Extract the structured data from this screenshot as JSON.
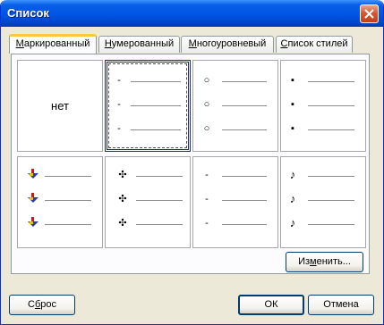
{
  "window": {
    "title": "Список"
  },
  "tabs": [
    {
      "label_ul": "М",
      "label_rest": "аркированный",
      "active": true
    },
    {
      "label_ul": "Н",
      "label_rest": "умерованный",
      "active": false
    },
    {
      "label_ul": "М",
      "label_rest": "ногоуровневый",
      "active": false
    },
    {
      "label_ul": "С",
      "label_rest": "писок стилей",
      "active": false
    }
  ],
  "bullet_styles": [
    {
      "none_label": "нет"
    },
    {
      "bullet": "-",
      "icon": "dash-bullet-icon",
      "selected": true
    },
    {
      "bullet": "○",
      "icon": "circle-bullet-icon"
    },
    {
      "bullet": "▪",
      "icon": "square-bullet-icon"
    },
    {
      "bullet": "",
      "icon": "colored-pointer-bullet-icon"
    },
    {
      "bullet": "✣",
      "icon": "four-diamond-bullet-icon"
    },
    {
      "bullet": "-",
      "icon": "small-dash-bullet-icon"
    },
    {
      "bullet": "♪",
      "icon": "note-bullet-icon"
    }
  ],
  "buttons": {
    "modify_pre": "Из",
    "modify_ul": "м",
    "modify_post": "енить...",
    "reset_pre": "С",
    "reset_ul": "б",
    "reset_post": "рос",
    "ok": "ОК",
    "cancel": "Отмена"
  },
  "colors": {
    "title_bar": "#0054e3",
    "close_button": "#d9552f",
    "tab_highlight": "#ffc83c"
  }
}
